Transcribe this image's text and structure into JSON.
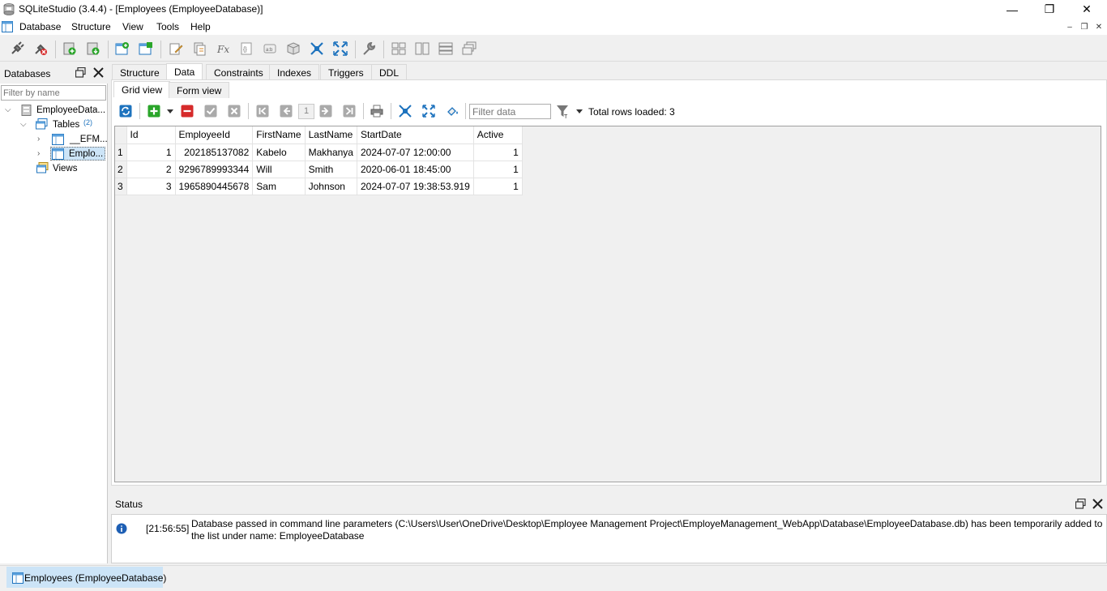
{
  "window": {
    "title": "SQLiteStudio (3.4.4) - [Employees (EmployeeDatabase)]",
    "minimize_glyph": "—",
    "restore_glyph": "❐",
    "close_glyph": "✕"
  },
  "menu": [
    "Database",
    "Structure",
    "View",
    "Tools",
    "Help"
  ],
  "mdi_controls": [
    "–",
    "❐",
    "✕"
  ],
  "left_panel": {
    "title": "Databases",
    "filter_placeholder": "Filter by name",
    "tree": {
      "database": "EmployeeData...",
      "tables_label": "Tables",
      "tables_count": "(2)",
      "tables": [
        "__EFM...",
        "Emplo..."
      ],
      "views_label": "Views"
    }
  },
  "main_tabs": [
    "Structure",
    "Data",
    "Constraints",
    "Indexes",
    "Triggers",
    "DDL"
  ],
  "active_main_tab": "Data",
  "sub_tabs": [
    "Grid view",
    "Form view"
  ],
  "grid_toolbar": {
    "page_number": "1",
    "filter_placeholder": "Filter data",
    "rows_loaded": "Total rows loaded: 3"
  },
  "grid": {
    "columns": [
      "Id",
      "EmployeeId",
      "FirstName",
      "LastName",
      "StartDate",
      "Active"
    ],
    "rows": [
      {
        "n": "1",
        "Id": "1",
        "EmployeeId": "202185137082",
        "FirstName": "Kabelo",
        "LastName": "Makhanya",
        "StartDate": "2024-07-07 12:00:00",
        "Active": "1"
      },
      {
        "n": "2",
        "Id": "2",
        "EmployeeId": "9296789993344",
        "FirstName": "Will",
        "LastName": "Smith",
        "StartDate": "2020-06-01 18:45:00",
        "Active": "1"
      },
      {
        "n": "3",
        "Id": "3",
        "EmployeeId": "1965890445678",
        "FirstName": "Sam",
        "LastName": "Johnson",
        "StartDate": "2024-07-07 19:38:53.919",
        "Active": "1"
      }
    ]
  },
  "status": {
    "title": "Status",
    "time": "[21:56:55]",
    "message_line1": "Database passed in command line parameters (C:\\Users\\User\\OneDrive\\Desktop\\Employee Management Project\\EmployeManagement_WebApp\\Database\\EmployeeDatabase.db) has been temporarily added to",
    "message_line2": "the list under name: EmployeeDatabase"
  },
  "taskbar": {
    "item": "Employees (EmployeeDatabase)"
  },
  "colors": {
    "accent_blue": "#1e73be",
    "add_green": "#2aa52a",
    "delete_red": "#d62b2b",
    "selection": "#cce4f7"
  }
}
